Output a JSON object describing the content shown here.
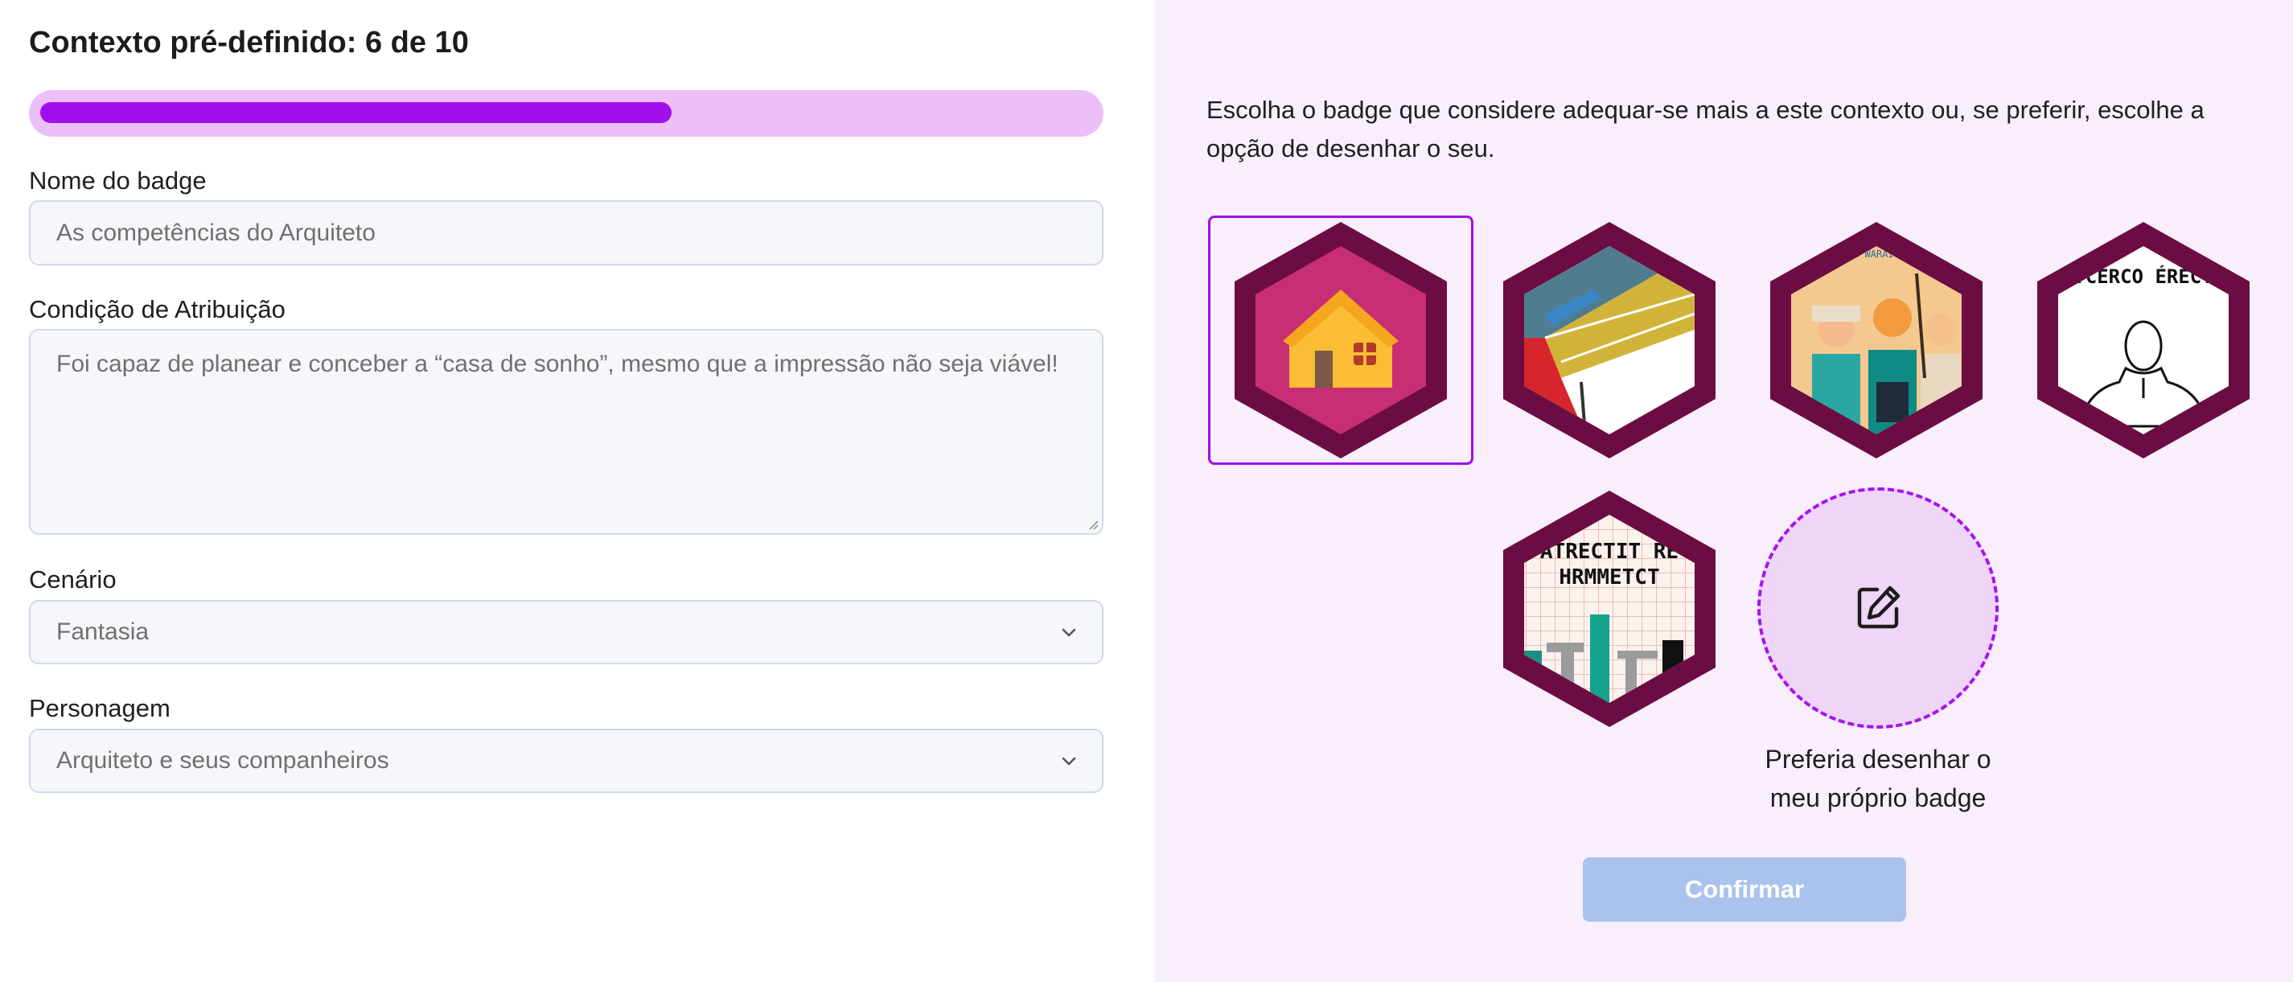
{
  "header": {
    "title": "Contexto pré-definido: 6 de 10"
  },
  "progress": {
    "value": 0.6
  },
  "form": {
    "badge_name_label": "Nome do badge",
    "badge_name_placeholder": "As competências do Arquiteto",
    "condition_label": "Condição de Atribuição",
    "condition_placeholder": "Foi capaz de planear e conceber a “casa de sonho”, mesmo que a impressão não seja viável!",
    "scenario_label": "Cenário",
    "scenario_value": "Fantasia",
    "character_label": "Personagem",
    "character_value": "Arquiteto e seus companheiros"
  },
  "badges": {
    "instructions": "Escolha o badge que considere adequar-se mais a este contexto ou, se preferir, escolhe a opção de desenhar o seu.",
    "items": [
      {
        "icon": "house-icon",
        "selected": true
      },
      {
        "icon": "architecture-abstract-icon",
        "selected": false
      },
      {
        "icon": "architect-team-icon",
        "selected": false
      },
      {
        "icon": "figure-sketch-icon",
        "selected": false
      },
      {
        "icon": "blueprint-icon",
        "selected": false
      }
    ],
    "badge_text_3": "NA IA AH   WARAIC IIA AH",
    "badge_text_4": "RTCERCO ÉRECTO",
    "badge_text_5a": "ATRECTIT RE",
    "badge_text_5b": "HRMMETCT",
    "draw_own_label": "Preferia desenhar o meu próprio badge",
    "draw_icon": "edit-icon",
    "confirm_label": "Confirmar"
  },
  "colors": {
    "accent": "#a010ec",
    "progress_track": "#edbff9",
    "panel_bg": "#f9eefc",
    "hex_frame": "#6b0d43",
    "confirm_disabled": "#aac3ec"
  }
}
